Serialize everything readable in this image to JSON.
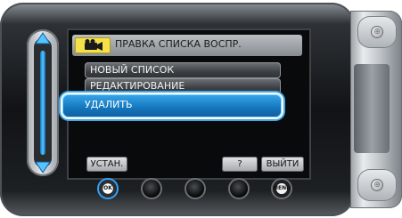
{
  "header": {
    "title": "ПРАВКА СПИСКА ВОСПР.",
    "icon": "video-camera-icon"
  },
  "menu": {
    "items": [
      {
        "label": "НОВЫЙ СПИСОК",
        "selected": false
      },
      {
        "label": "РЕДАКТИРОВАНИЕ",
        "selected": false
      },
      {
        "label": "УДАЛИТЬ",
        "selected": true
      }
    ]
  },
  "soft_buttons": {
    "set": "УСТАН.",
    "help": "?",
    "exit": "ВЫЙТИ"
  },
  "hardware_buttons": {
    "ok": "OK",
    "menu": "MENU"
  },
  "colors": {
    "highlight": "#1a7fc8",
    "slider_bar": "#3aaaf0",
    "icon_bg": "#f4e04a"
  }
}
